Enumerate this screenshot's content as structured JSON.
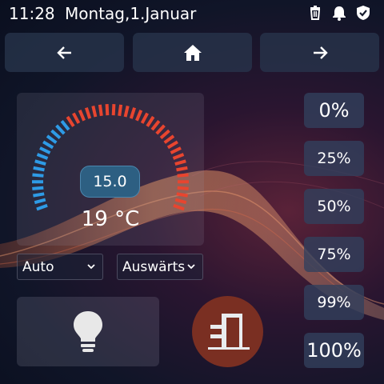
{
  "status_bar": {
    "time": "11:28",
    "date": "Montag,1.Januar",
    "icons": [
      "trash-icon",
      "bell-icon",
      "shield-check-icon"
    ]
  },
  "nav": {
    "back_icon": "arrow-left-icon",
    "home_icon": "home-icon",
    "forward_icon": "arrow-right-icon"
  },
  "thermostat": {
    "setpoint": "15.0",
    "current_temperature": "19 °C",
    "mode_value": "Auto",
    "preset_value": "Auswärts",
    "colors": {
      "cool": "#2e9be6",
      "heat": "#e8452f"
    }
  },
  "light": {
    "icon": "lightbulb-icon"
  },
  "door": {
    "icon": "door-open-icon",
    "color": "#7a2f22"
  },
  "cover_positions": [
    {
      "label": "0%"
    },
    {
      "label": "25%"
    },
    {
      "label": "50%"
    },
    {
      "label": "75%"
    },
    {
      "label": "99%"
    },
    {
      "label": "100%"
    }
  ]
}
